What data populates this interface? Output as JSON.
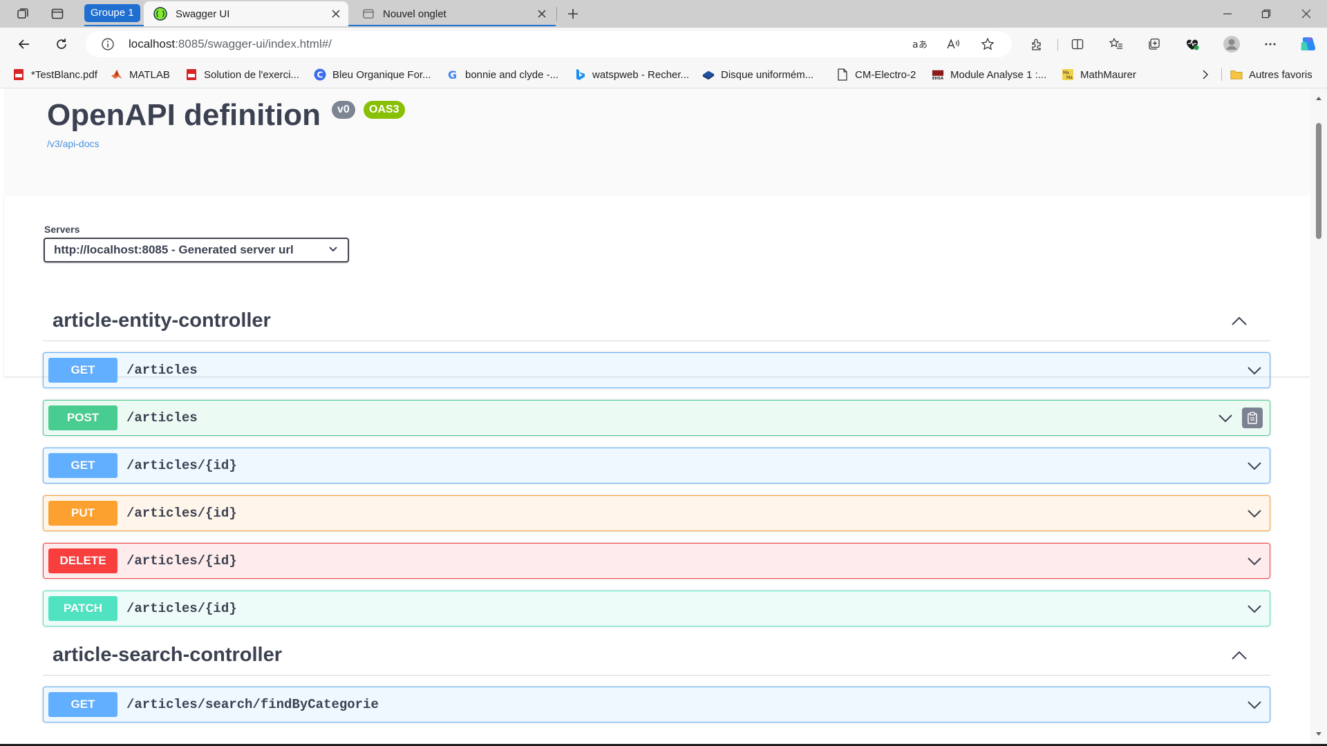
{
  "browser": {
    "tab_group": "Groupe 1",
    "tabs": [
      {
        "title": "Swagger UI",
        "active": true
      },
      {
        "title": "Nouvel onglet",
        "active": false
      }
    ],
    "address": {
      "host": "localhost",
      "rest": ":8085/swagger-ui/index.html#/"
    },
    "bookmarks": [
      {
        "label": "*TestBlanc.pdf",
        "icon": "pdf-icon"
      },
      {
        "label": "MATLAB",
        "icon": "matlab-icon"
      },
      {
        "label": "Solution de l'exerci...",
        "icon": "pdf-icon"
      },
      {
        "label": "Bleu Organique For...",
        "icon": "canva-icon"
      },
      {
        "label": "bonnie and clyde -...",
        "icon": "google-icon"
      },
      {
        "label": "watspweb - Recher...",
        "icon": "bing-icon"
      },
      {
        "label": "Disque uniformém...",
        "icon": "book-icon"
      },
      {
        "label": "CM-Electro-2",
        "icon": "page-icon"
      },
      {
        "label": "Module Analyse 1 :...",
        "icon": "ehsa-icon"
      },
      {
        "label": "MathMaurer",
        "icon": "mathmaurer-icon"
      }
    ],
    "other_favorites": "Autres favoris"
  },
  "swagger": {
    "title": "OpenAPI definition",
    "version_badge": "v0",
    "oas_badge": "OAS3",
    "spec_link": "/v3/api-docs",
    "servers_label": "Servers",
    "server_selected": "http://localhost:8085 - Generated server url",
    "tags": [
      {
        "name": "article-entity-controller",
        "operations": [
          {
            "method": "GET",
            "path": "/articles"
          },
          {
            "method": "POST",
            "path": "/articles"
          },
          {
            "method": "GET",
            "path": "/articles/{id}"
          },
          {
            "method": "PUT",
            "path": "/articles/{id}"
          },
          {
            "method": "DELETE",
            "path": "/articles/{id}"
          },
          {
            "method": "PATCH",
            "path": "/articles/{id}"
          }
        ]
      },
      {
        "name": "article-search-controller",
        "operations": [
          {
            "method": "GET",
            "path": "/articles/search/findByCategorie"
          }
        ]
      }
    ]
  },
  "colors": {
    "get": "#61affe",
    "post": "#49cc90",
    "put": "#fca130",
    "delete": "#f93e3e",
    "patch": "#50e3c2",
    "tab_group": "#1f6fd1",
    "oas_badge": "#89bf04",
    "version_badge": "#7d8492"
  }
}
